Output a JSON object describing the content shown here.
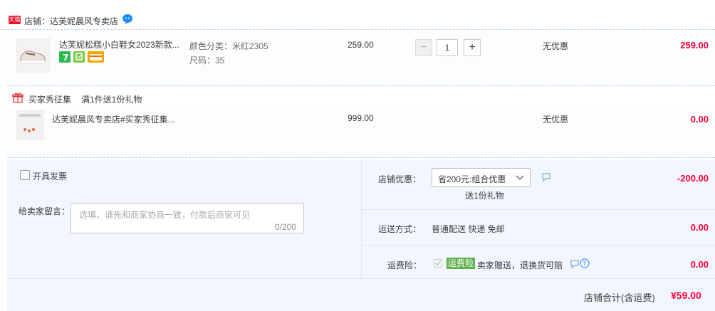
{
  "shop": {
    "logo_text": "天猫",
    "label": "店铺：达芙妮晨风专卖店"
  },
  "items": [
    {
      "title": "达芙妮松糕小白鞋女2023新款...",
      "sku_color": "颜色分类：米红2305",
      "sku_size": "尺码：35",
      "price": "259.00",
      "quantity": "1",
      "promo": "无优惠",
      "total": "259.00",
      "badges": [
        "7-day-return-icon",
        "guarantee-icon",
        "card-icon"
      ]
    },
    {
      "title": "达芙妮晨风专卖店#买家秀征集...",
      "price": "999.00",
      "promo": "无优惠",
      "total": "0.00"
    }
  ],
  "gift": {
    "icon": "gift-icon",
    "label": "买家秀征集",
    "desc": "满1件送1份礼物"
  },
  "invoice": {
    "label": "开具发票"
  },
  "message": {
    "label": "给卖家留言：",
    "placeholder": "选填，请先和商家协商一致，付款后商家可见",
    "counter": "0/200"
  },
  "shop_discount": {
    "label": "店铺优惠：",
    "selected": "省200元:组合优惠",
    "note": "送1份礼物",
    "amount": "-200.00"
  },
  "shipping": {
    "label": "运送方式：",
    "value": "普通配送 快递 免邮",
    "amount": "0.00"
  },
  "insurance": {
    "label": "运费险：",
    "tag": "运费险",
    "desc": "卖家赠送，退换货可赔",
    "amount": "0.00"
  },
  "grand_total": {
    "label": "店铺合计(含运费)",
    "value": "¥59.00"
  },
  "colors": {
    "accent_red": "#ff0036",
    "summary_bg": "#f2f7ff",
    "divider": "#b6d1e6"
  }
}
